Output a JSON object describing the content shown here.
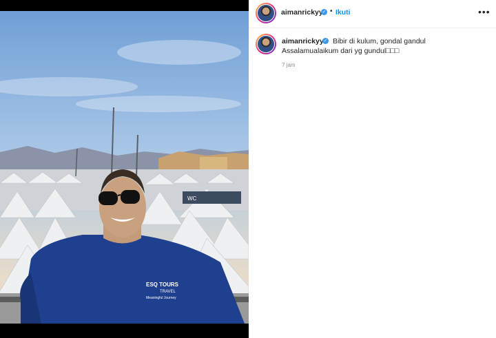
{
  "post": {
    "username": "aimanrickyy",
    "dot": "•",
    "follow_label": "Ikuti",
    "more_label": "•••",
    "verified_mark": "✓",
    "caption_line1": "Bibir di kulum, gondal gandul",
    "caption_line2": "Assalamualaikum dari yg gundul□□□",
    "timestamp": "7 jam",
    "shirt_text_1": "ESQ TOURS",
    "shirt_text_2": "TRAVEL",
    "shirt_text_3": "Meaningful Journey",
    "sign_text": "WC"
  },
  "colors": {
    "follow": "#0095f6",
    "verified": "#3897f0",
    "shirt": "#1f3f8f",
    "sky": "#8fb3dd"
  }
}
